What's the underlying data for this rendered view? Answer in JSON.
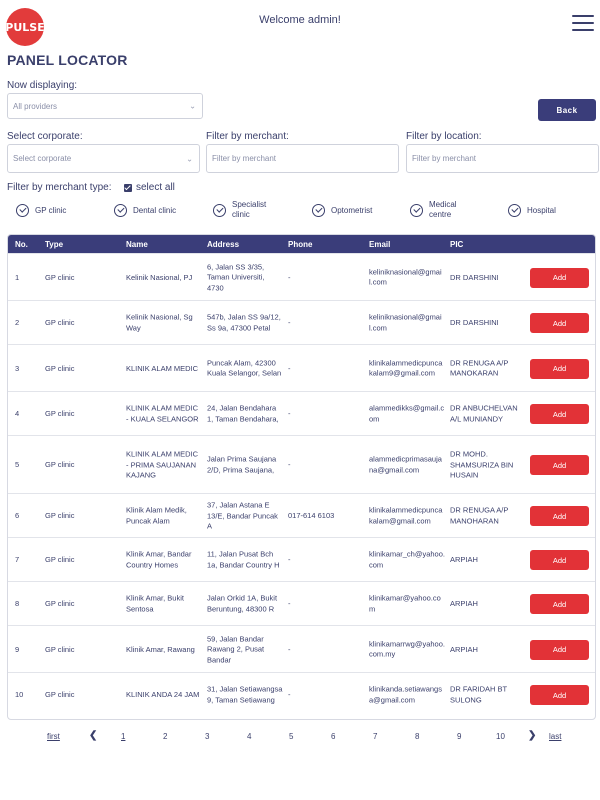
{
  "header": {
    "logo_text": "PULSE",
    "welcome": "Welcome admin!",
    "menu_icon": "hamburger-icon"
  },
  "page": {
    "title": "PANEL LOCATOR"
  },
  "filters": {
    "now_displaying_label": "Now displaying:",
    "now_displaying_value": "All providers",
    "back_label": "Back",
    "corporate_label": "Select corporate:",
    "corporate_placeholder": "Select corporate",
    "merchant_label": "Filter by merchant:",
    "merchant_placeholder": "Filter by merchant",
    "location_label": "Filter by location:",
    "location_placeholder": "Filter by merchant",
    "merchant_type_label": "Filter by merchant type:",
    "select_all_label": "select all",
    "types": [
      "GP clinic",
      "Dental clinic",
      "Specialist clinic",
      "Optometrist",
      "Medical centre",
      "Hospital"
    ]
  },
  "table": {
    "headers": [
      "No.",
      "Type",
      "Name",
      "Address",
      "Phone",
      "Email",
      "PIC"
    ],
    "add_label": "Add",
    "rows": [
      {
        "no": "1",
        "type": "GP clinic",
        "name": "Kelinik Nasional, PJ",
        "address": "6, Jalan SS 3/35, Taman Universiti, 4730",
        "phone": "-",
        "email": "keliniknasional@gmail.com",
        "pic": "DR DARSHINI"
      },
      {
        "no": "2",
        "type": "GP clinic",
        "name": "Kelinik Nasional, Sg Way",
        "address": "547b, Jalan SS 9a/12, Ss 9a, 47300 Petal",
        "phone": "-",
        "email": "keliniknasional@gmail.com",
        "pic": "DR DARSHINI"
      },
      {
        "no": "3",
        "type": "GP clinic",
        "name": "KLINIK ALAM MEDIC",
        "address": "Puncak Alam, 42300 Kuala Selangor, Selan",
        "phone": "-",
        "email": "klinikalammedicpuncakalam9@gmail.com",
        "pic": "DR RENUGA A/P MANOKARAN"
      },
      {
        "no": "4",
        "type": "GP clinic",
        "name": "KLINIK ALAM MEDIC - KUALA SELANGOR",
        "address": "24, Jalan Bendahara 1, Taman Bendahara,",
        "phone": "-",
        "email": "alammedikks@gmail.com",
        "pic": "DR ANBUCHELVAN A/L MUNIANDY"
      },
      {
        "no": "5",
        "type": "GP clinic",
        "name": "KLINIK ALAM MEDIC - PRIMA SAUJANAN KAJANG",
        "address": "Jalan Prima Saujana 2/D, Prima Saujana,",
        "phone": "-",
        "email": "alammedicprimasaujana@gmail.com",
        "pic": "DR MOHD. SHAMSURIZA BIN HUSAIN"
      },
      {
        "no": "6",
        "type": "GP clinic",
        "name": "Klinik Alam Medik, Puncak Alam",
        "address": "37, Jalan Astana E 13/E, Bandar Puncak A",
        "phone": "017-614 6103",
        "email": "klinikalammedicpuncakalam@gmail.com",
        "pic": "DR RENUGA A/P MANOHARAN"
      },
      {
        "no": "7",
        "type": "GP clinic",
        "name": "Klinik Amar, Bandar Country Homes",
        "address": "11, Jalan Pusat Bch 1a, Bandar Country H",
        "phone": "-",
        "email": "klinikamar_ch@yahoo.com",
        "pic": "ARPIAH"
      },
      {
        "no": "8",
        "type": "GP clinic",
        "name": "Klinik Amar, Bukit Sentosa",
        "address": "Jalan Orkid 1A, Bukit Beruntung, 48300 R",
        "phone": "-",
        "email": "klinikamar@yahoo.com",
        "pic": "ARPIAH"
      },
      {
        "no": "9",
        "type": "GP clinic",
        "name": "Klinik Amar, Rawang",
        "address": "59, Jalan Bandar Rawang 2, Pusat Bandar",
        "phone": "-",
        "email": "klinikamarrwg@yahoo.com.my",
        "pic": "ARPIAH"
      },
      {
        "no": "10",
        "type": "GP clinic",
        "name": "KLINIK ANDA 24 JAM",
        "address": "31, Jalan Setiawangsa 9, Taman Setiawang",
        "phone": "-",
        "email": "klinikanda.setiawangsa@gmail.com",
        "pic": "DR FARIDAH BT SULONG"
      }
    ]
  },
  "pagination": {
    "first": "first",
    "prev_icon": "chevron-left-icon",
    "pages": [
      "1",
      "2",
      "3",
      "4",
      "5",
      "6",
      "7",
      "8",
      "9",
      "10"
    ],
    "current": "1",
    "next_icon": "chevron-right-icon",
    "last": "last"
  },
  "colors": {
    "primary": "#3a3d7a",
    "accent": "#e23237"
  }
}
